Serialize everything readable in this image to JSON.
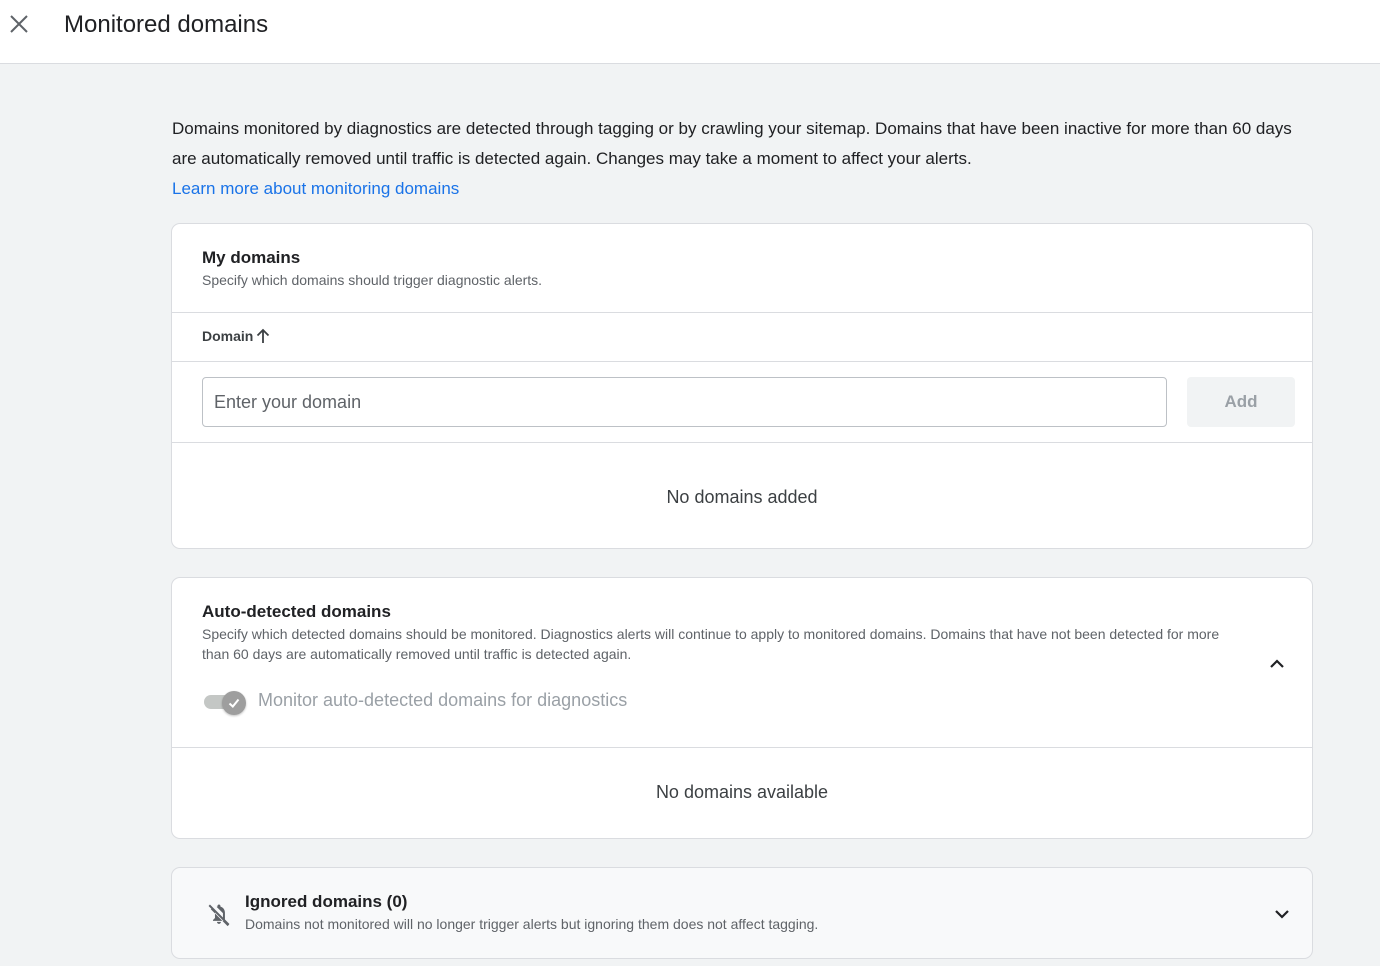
{
  "header": {
    "title": "Monitored domains"
  },
  "intro": {
    "text": "Domains monitored by diagnostics are detected through tagging or by crawling your sitemap. Domains that have been inactive for more than 60 days are automatically removed until traffic is detected again. Changes may take a moment to affect your alerts.",
    "link_label": "Learn more about monitoring domains"
  },
  "my_domains": {
    "title": "My domains",
    "subtitle": "Specify which domains should trigger diagnostic alerts.",
    "column_header": "Domain",
    "input_placeholder": "Enter your domain",
    "add_label": "Add",
    "empty_message": "No domains added"
  },
  "auto_detected": {
    "title": "Auto-detected domains",
    "subtitle": "Specify which detected domains should be monitored. Diagnostics alerts will continue to apply to monitored domains. Domains that have not been detected for more than 60 days are automatically removed until traffic is detected again.",
    "toggle_label": "Monitor auto-detected domains for diagnostics",
    "toggle_on": true,
    "toggle_disabled": true,
    "empty_message": "No domains available"
  },
  "ignored": {
    "title": "Ignored domains (0)",
    "subtitle": "Domains not monitored will no longer trigger alerts but ignoring them does not affect tagging."
  },
  "colors": {
    "link": "#1a73e8",
    "border": "#dadce0",
    "background": "#f1f3f4"
  }
}
